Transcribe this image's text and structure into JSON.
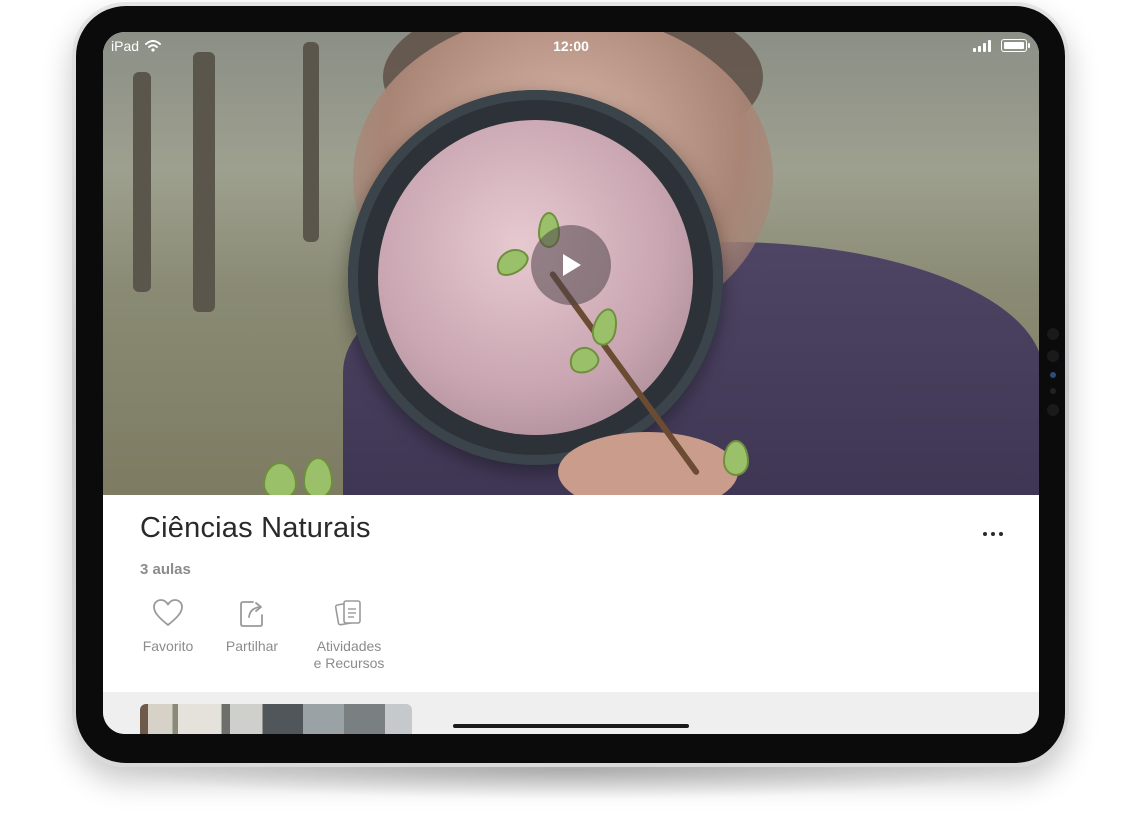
{
  "status_bar": {
    "device": "iPad",
    "time": "12:00",
    "icons": [
      "wifi-icon",
      "cellular-signal-icon",
      "battery-icon"
    ]
  },
  "hero": {
    "image": "child-magnifying-glass-leaf-buds-photo",
    "play_icon": "play-icon"
  },
  "course": {
    "title": "Ciências Naturais",
    "lessons": "3 aulas",
    "more_icon": "more-horizontal-icon"
  },
  "actions": [
    {
      "label": "Favorito",
      "icon": "heart-icon"
    },
    {
      "label": "Partilhar",
      "icon": "share-icon"
    },
    {
      "label": "Atividades\ne Recursos",
      "icon": "documents-icon"
    }
  ],
  "colors": {
    "title": "#2a2a2a",
    "secondary_text": "#8c8c8c",
    "strip_background": "#efeff0"
  }
}
